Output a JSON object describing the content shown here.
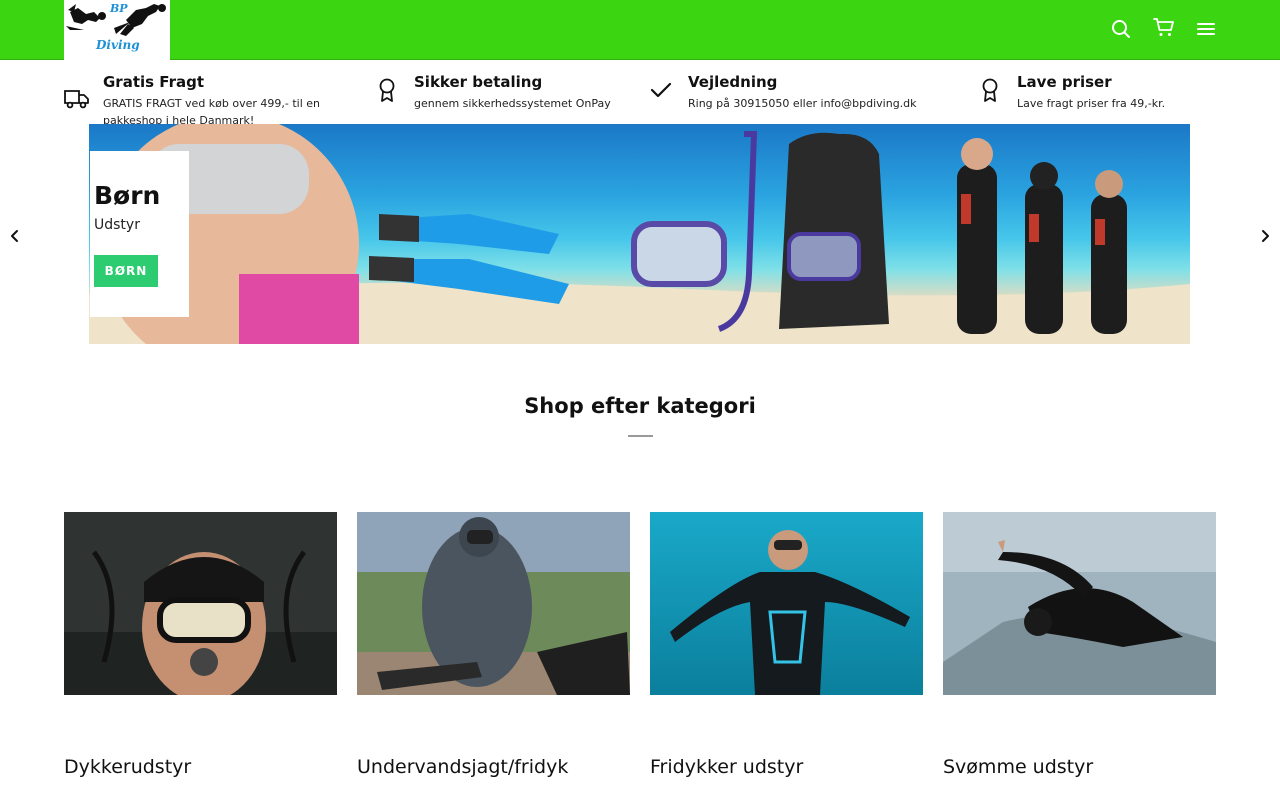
{
  "header": {
    "logo": {
      "line1": "BP",
      "line2": "Diving"
    },
    "icons": [
      "search-icon",
      "cart-icon",
      "menu-icon"
    ]
  },
  "usps": [
    {
      "title": "Gratis Fragt",
      "subtitle": "GRATIS FRAGT ved køb over 499,- til en pakkeshop i hele Danmark!",
      "icon": "truck-icon"
    },
    {
      "title": "Sikker betaling",
      "subtitle": "gennem sikkerhedssystemet OnPay",
      "icon": "award-icon"
    },
    {
      "title": "Vejledning",
      "subtitle": "Ring på 30915050 eller info@bpdiving.dk",
      "icon": "check-icon"
    },
    {
      "title": "Lave priser",
      "subtitle": "Lave fragt priser fra 49,-kr.",
      "icon": "award-icon"
    }
  ],
  "hero": {
    "title": "Børn",
    "subtitle": "Udstyr",
    "button": "BØRN"
  },
  "section": {
    "title": "Shop efter kategori"
  },
  "categories": [
    {
      "label": "Dykkerudstyr"
    },
    {
      "label": "Undervandsjagt/fridyk"
    },
    {
      "label": "Fridykker udstyr"
    },
    {
      "label": "Svømme udstyr"
    }
  ],
  "colors": {
    "header": "#3bd511",
    "button": "#2ecc71",
    "logo_text": "#1e90d6"
  }
}
